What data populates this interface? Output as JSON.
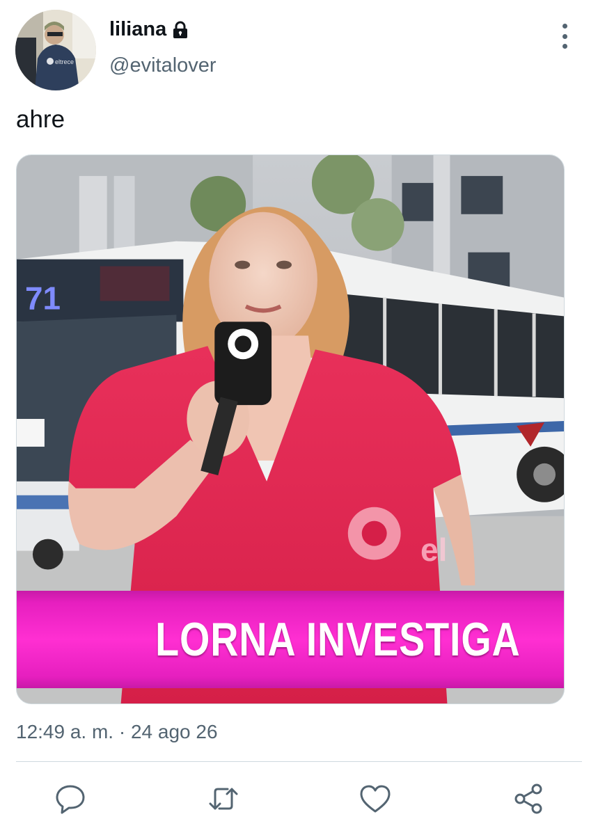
{
  "user": {
    "display_name": "liliana",
    "handle": "@evitalover",
    "avatar_watermark": "eltrece"
  },
  "tweet": {
    "text": "ahre",
    "timestamp": "12:49 a. m. · 24 ago 26"
  },
  "media": {
    "bus_number": "71",
    "lower_third": "LORNA INVESTIGA",
    "channel_mark": "el"
  },
  "actions": [
    {
      "icon": "reply-icon"
    },
    {
      "icon": "retweet-icon"
    },
    {
      "icon": "like-icon"
    },
    {
      "icon": "share-icon"
    }
  ],
  "colors": {
    "text_primary": "#0f1419",
    "text_secondary": "#536471",
    "divider": "#cfd9de",
    "banner_magenta": "#ff2fd2"
  }
}
